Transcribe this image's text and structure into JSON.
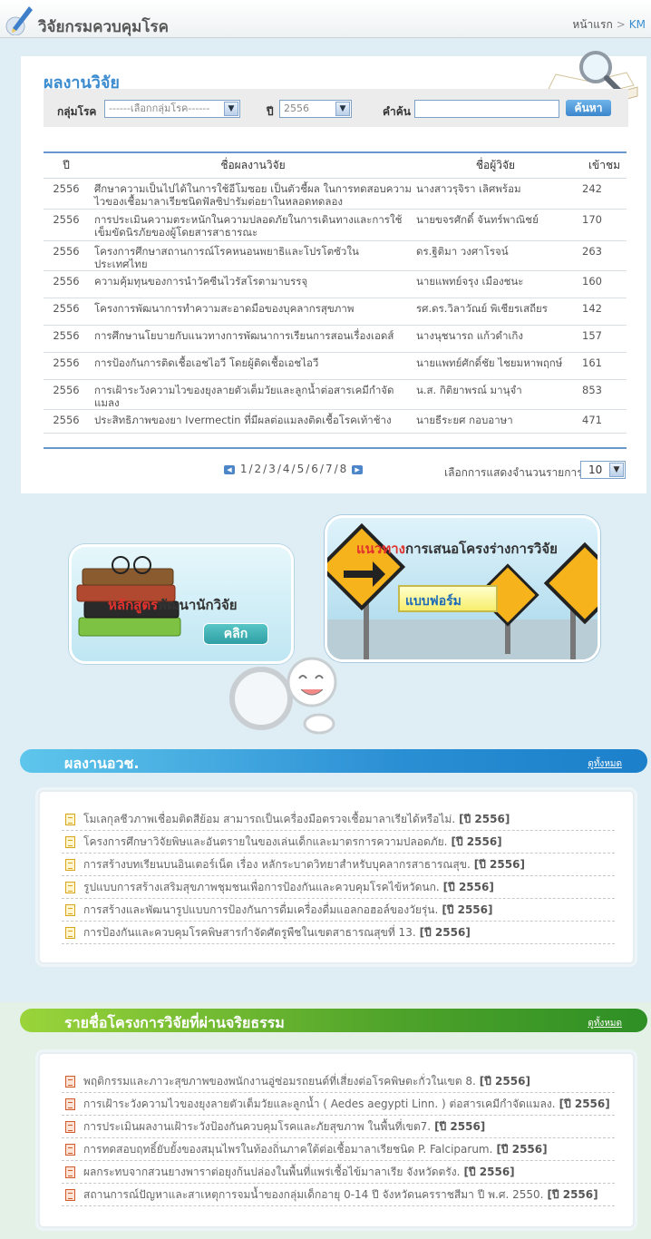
{
  "header": {
    "site_title": "วิจัยกรมควบคุมโรค",
    "breadcrumb_home": "หน้าแรก",
    "breadcrumb_sep": ">",
    "breadcrumb_km": "KM"
  },
  "research": {
    "title": "ผลงานวิจัย",
    "search": {
      "group_label": "กลุ่มโรค",
      "group_value": "------เลือกกลุ่มโรค------",
      "year_label": "ปี",
      "year_value": "2556",
      "keyword_label": "คำค้น",
      "keyword_value": "",
      "button": "ค้นหา"
    },
    "columns": [
      "ปี",
      "ชื่อผลงานวิจัย",
      "ชื่อผู้วิจัย",
      "เข้าชม"
    ],
    "rows": [
      {
        "year": "2556",
        "title": "ศึกษาความเป็นไปได้ในการใช้อีโมซอย เป็นตัวชี้ผล ในการทดสอบความไวของเชื้อมาลาเรียชนิดฟัลซิปารัมต่อยาในหลอดทดลอง",
        "author": "นางสาวรุจิรา เลิศพร้อม",
        "views": "242"
      },
      {
        "year": "2556",
        "title": "การประเมินความตระหนักในความปลอดภัยในการเดินทางและการใช้เข็มขัดนิรภัยของผู้โดยสารสาธารณะ",
        "author": "นายขจรศักดิ์ จันทร์พาณิชย์",
        "views": "170"
      },
      {
        "year": "2556",
        "title": "โครงการศึกษาสถานการณ์โรคหนอนพยาธิและโปรโตซัวในประเทศไทย",
        "author": "ดร.ฐิติมา วงศาโรจน์",
        "views": "263"
      },
      {
        "year": "2556",
        "title": "ความคุ้มทุนของการนำวัคซีนไวรัสโรตามาบรรจุ",
        "author": "นายแพทย์จรุง เมืองชนะ",
        "views": "160"
      },
      {
        "year": "2556",
        "title": "โครงการพัฒนาการทำความสะอาดมือของบุคลากรสุขภาพ",
        "author": "รศ.ดร.วิลาวัณย์ พิเชียรเสถียร",
        "views": "142"
      },
      {
        "year": "2556",
        "title": "การศึกษานโยบายกับแนวทางการพัฒนาการเรียนการสอนเรื่องเอดส์",
        "author": "นางนุชนารถ แก้วดำเกิง",
        "views": "157"
      },
      {
        "year": "2556",
        "title": "การป้องกันการติดเชื้อเอชไอวี โดยผู้ติดเชื้อเอชไอวี",
        "author": "นายแพทย์ศักดิ์ชัย ไชยมหาพฤกษ์",
        "views": "161"
      },
      {
        "year": "2556",
        "title": "การเฝ้าระวังความไวของยุงลายตัวเต็มวัยและลูกน้ำต่อสารเคมีกำจัดแมลง",
        "author": "น.ส. กิติยาพรณ์ มานุจำ",
        "views": "853"
      },
      {
        "year": "2556",
        "title": "ประสิทธิภาพของยา Ivermectin ที่มีผลต่อแมลงติดเชื้อโรคเท้าช้าง",
        "author": "นายธีระยศ กอบอาษา",
        "views": "471"
      }
    ],
    "pager": {
      "prev": "◀",
      "next": "▶",
      "pages": [
        "1",
        "2",
        "3",
        "4",
        "5",
        "6",
        "7",
        "8"
      ],
      "per_page_label": "เลือกการแสดงจำนวนรายการ",
      "per_page_value": "10"
    }
  },
  "promo": {
    "course_red": "หลักสูตร",
    "course_rest": "พัฒนานักวิจัย",
    "click": "คลิก",
    "guide_red": "แนวทาง",
    "guide_rest": "การเสนอโครงร่างการวิจัย",
    "form": "แบบฟอร์ม"
  },
  "section_dcd": {
    "title": "ผลงานอวช.",
    "see_all": "ดูทั้งหมด",
    "items": [
      {
        "text": "โมเลกุลชีวภาพเชื่อมติดสีย้อม สามารถเป็นเครื่องมือตรวจเชื้อมาลาเรียได้หรือไม่.",
        "year": "[ปี 2556]"
      },
      {
        "text": "โครงการศึกษาวิจัยพิษและอันตรายในของเล่นเด็กและมาตรการความปลอดภัย.",
        "year": "[ปี 2556]"
      },
      {
        "text": "การสร้างบทเรียนบนอินเตอร์เน็ต เรื่อง หลักระบาดวิทยาสำหรับบุคลากรสาธารณสุข.",
        "year": "[ปี 2556]"
      },
      {
        "text": "รูปแบบการสร้างเสริมสุขภาพชุมชนเพื่อการป้องกันและควบคุมโรคไข้หวัดนก.",
        "year": "[ปี 2556]"
      },
      {
        "text": "การสร้างและพัฒนารูปแบบการป้องกันการดื่มเครื่องดื่มแอลกอฮอล์ของวัยรุ่น.",
        "year": "[ปี 2556]"
      },
      {
        "text": "การป้องกันและควบคุมโรคพิษสารกำจัดศัตรูพืชในเขตสาธารณสุขที่ 13.",
        "year": "[ปี 2556]"
      }
    ]
  },
  "section_ethics": {
    "title": "รายชื่อโครงการวิจัยที่ผ่านจริยธรรม",
    "see_all": "ดูทั้งหมด",
    "items": [
      {
        "text": "พฤติกรรมและภาวะสุขภาพของพนักงานอู่ซ่อมรถยนต์ที่เสี่ยงต่อโรคพิษตะกั่วในเขต 8.",
        "year": "[ปี 2556]"
      },
      {
        "text": "การเฝ้าระวังความไวของยุงลายตัวเต็มวัยและลูกน้ำ ( Aedes aegypti Linn. ) ต่อสารเคมีกำจัดแมลง.",
        "year": "[ปี 2556]"
      },
      {
        "text": "การประเมินผลงานเฝ้าระวังป้องกันควบคุมโรคและภัยสุขภาพ ในพื้นที่เขต7.",
        "year": "[ปี 2556]"
      },
      {
        "text": "การทดสอบฤทธิ์ยับยั้งของสมุนไพรในท้องถิ่นภาคใต้ต่อเชื้อมาลาเรียชนิด P. Falciparum.",
        "year": "[ปี 2556]"
      },
      {
        "text": "ผลกระทบจากสวนยางพาราต่อยุงก้นปล่องในพื้นที่แพร่เชื้อไข้มาลาเรีย จังหวัดตรัง.",
        "year": "[ปี 2556]"
      },
      {
        "text": "สถานการณ์ปัญหาและสาเหตุการจมน้ำของกลุ่มเด็กอายุ 0-14 ปี จังหวัดนครราชสีมา ปี พ.ศ. 2550.",
        "year": "[ปี 2556]"
      }
    ]
  }
}
